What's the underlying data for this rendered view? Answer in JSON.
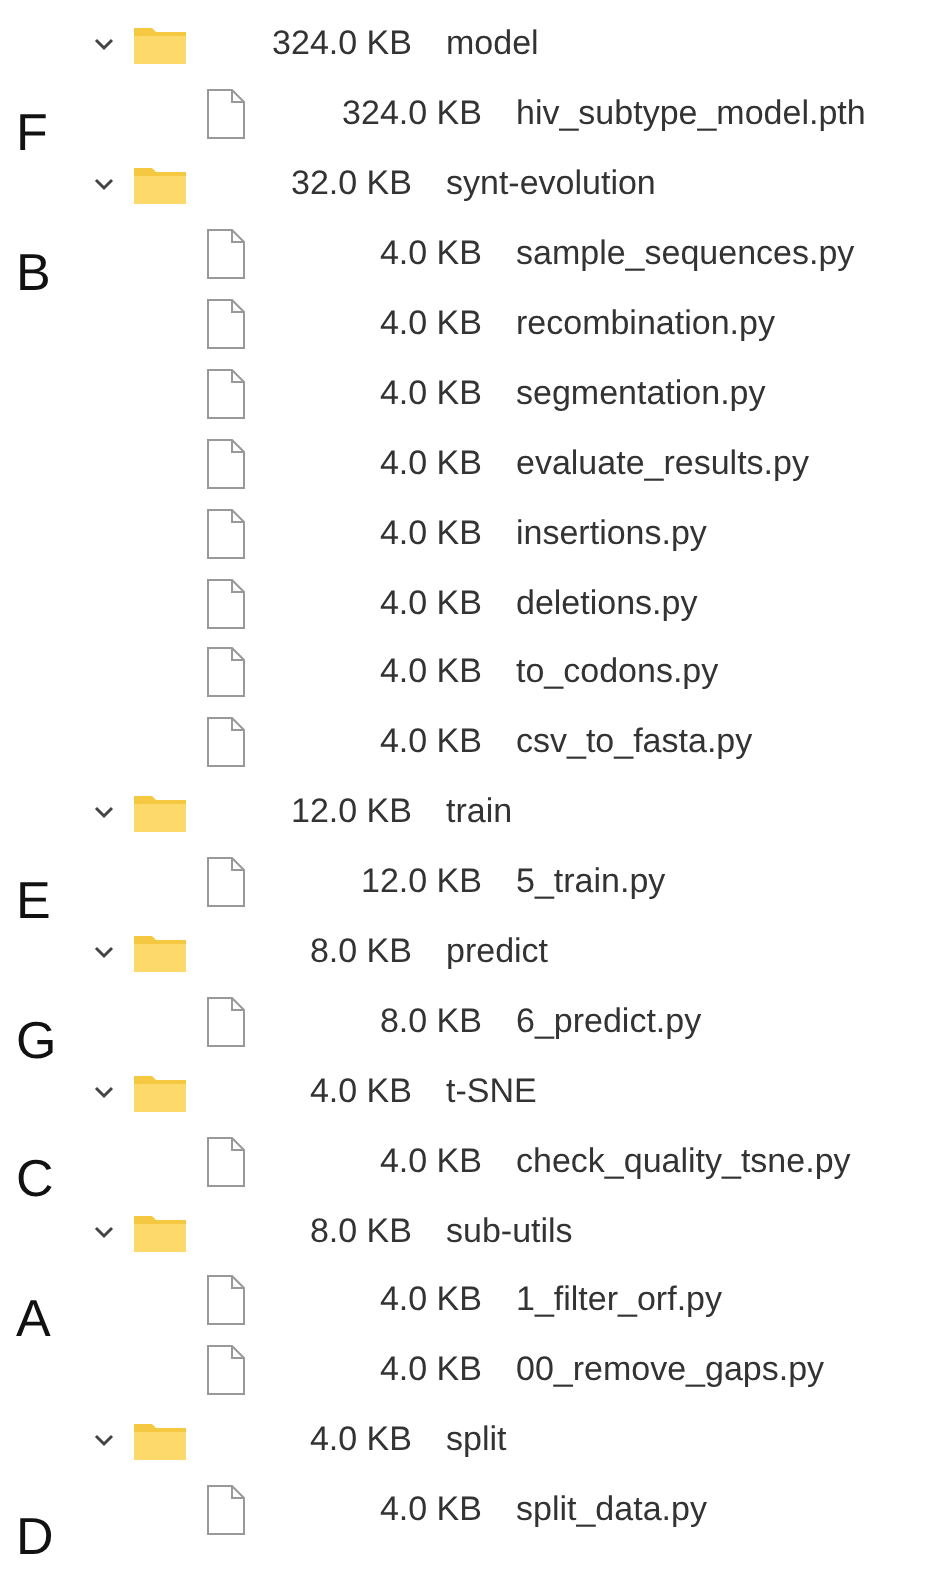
{
  "groups": [
    {
      "label": "F",
      "folder": {
        "size": "324.0 KB",
        "name": "model",
        "expanded": true
      },
      "files": [
        {
          "size": "324.0 KB",
          "name": "hiv_subtype_model.pth"
        }
      ]
    },
    {
      "label": "B",
      "folder": {
        "size": "32.0 KB",
        "name": "synt-evolution",
        "expanded": true
      },
      "files": [
        {
          "size": "4.0 KB",
          "name": "sample_sequences.py"
        },
        {
          "size": "4.0 KB",
          "name": "recombination.py"
        },
        {
          "size": "4.0 KB",
          "name": "segmentation.py"
        },
        {
          "size": "4.0 KB",
          "name": "evaluate_results.py"
        },
        {
          "size": "4.0 KB",
          "name": "insertions.py"
        },
        {
          "size": "4.0 KB",
          "name": "deletions.py"
        },
        {
          "size": "4.0 KB",
          "name": "to_codons.py"
        },
        {
          "size": "4.0 KB",
          "name": "csv_to_fasta.py"
        }
      ]
    },
    {
      "label": "E",
      "folder": {
        "size": "12.0 KB",
        "name": "train",
        "expanded": true
      },
      "files": [
        {
          "size": "12.0 KB",
          "name": "5_train.py"
        }
      ]
    },
    {
      "label": "G",
      "folder": {
        "size": "8.0 KB",
        "name": "predict",
        "expanded": true
      },
      "files": [
        {
          "size": "8.0 KB",
          "name": "6_predict.py"
        }
      ]
    },
    {
      "label": "C",
      "folder": {
        "size": "4.0 KB",
        "name": "t-SNE",
        "expanded": true
      },
      "files": [
        {
          "size": "4.0 KB",
          "name": "check_quality_tsne.py"
        }
      ]
    },
    {
      "label": "A",
      "folder": {
        "size": "8.0 KB",
        "name": "sub-utils",
        "expanded": true
      },
      "files": [
        {
          "size": "4.0 KB",
          "name": "1_filter_orf.py"
        },
        {
          "size": "4.0 KB",
          "name": "00_remove_gaps.py"
        }
      ]
    },
    {
      "label": "D",
      "folder": {
        "size": "4.0 KB",
        "name": "split",
        "expanded": true
      },
      "files": [
        {
          "size": "4.0 KB",
          "name": "split_data.py"
        }
      ]
    }
  ]
}
